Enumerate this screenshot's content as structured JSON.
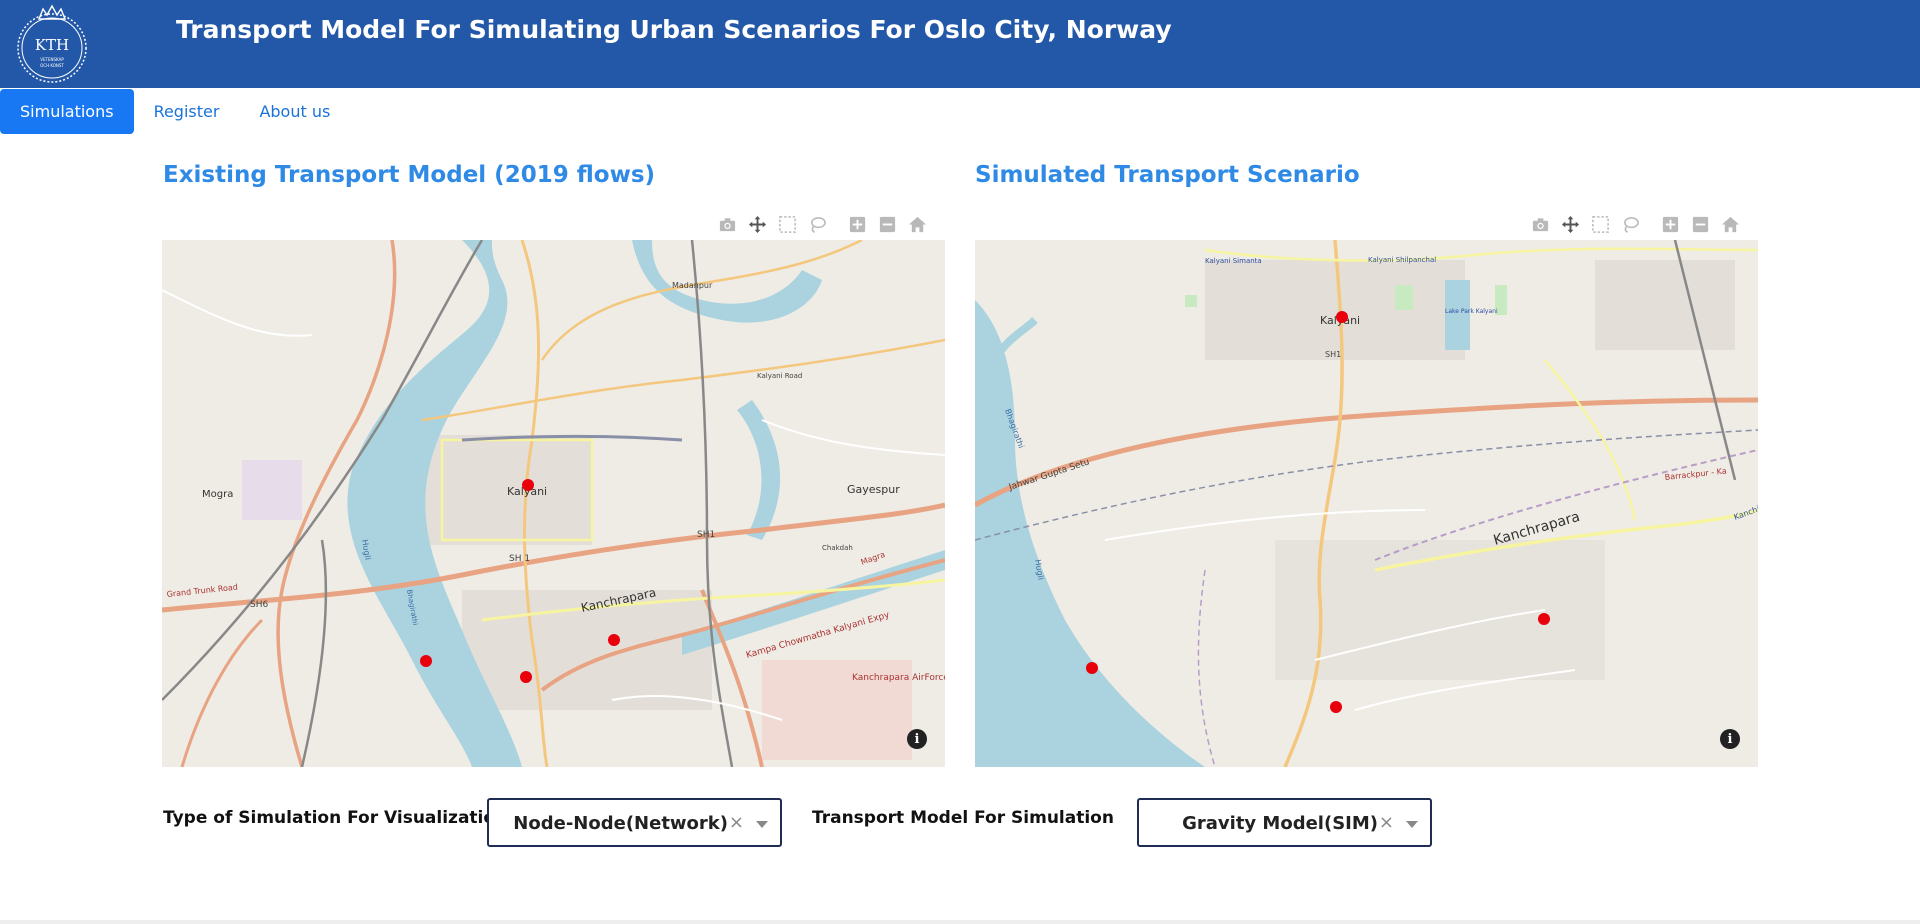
{
  "header": {
    "title": "Transport Model For Simulating Urban Scenarios For Oslo City, Norway",
    "logo_text": "KTH",
    "logo_subtext": "VETENSKAP OCH KONST",
    "background_color": "#2358a8"
  },
  "nav": {
    "items": [
      {
        "label": "Simulations",
        "active": true
      },
      {
        "label": "Register",
        "active": false
      },
      {
        "label": "About us",
        "active": false
      }
    ],
    "active_color": "#1877f2"
  },
  "panels": {
    "existing": {
      "title": "Existing Transport Model (2019 flows)",
      "modebar": [
        "camera-icon",
        "pan-icon",
        "box-select-icon",
        "lasso-select-icon",
        "zoom-in-icon",
        "zoom-out-icon",
        "reset-home-icon"
      ],
      "map_labels": [
        "Kalyani",
        "Kanchrapara",
        "Gayespur",
        "Mogra",
        "SH 1",
        "SH1",
        "SH6",
        "Grand Trunk Road",
        "Kampa Chowmatha Kalyani Expy",
        "Kanchrapara AirForce Area",
        "Hugli",
        "Madanpur",
        "Kalyani Road",
        "Chakdah",
        "Bhagirathi",
        "Magra"
      ],
      "info_label": "i"
    },
    "simulated": {
      "title": "Simulated Transport Scenario",
      "modebar": [
        "camera-icon",
        "pan-icon",
        "box-select-icon",
        "lasso-select-icon",
        "zoom-in-icon",
        "zoom-out-icon",
        "reset-home-icon"
      ],
      "map_labels": [
        "Kalyani",
        "Kanchrapara",
        "Kalyani Simanta",
        "Kalyani Shilpanchal",
        "Lake Park Kalyani",
        "SH1",
        "Jahwar Gupta Setu",
        "Bhagirathi",
        "Hugli",
        "Barrackpur - Ka",
        "Kanchi"
      ],
      "info_label": "i"
    }
  },
  "controls": {
    "simulation_type": {
      "label": "Type of Simulation For Visualization",
      "value": "Node-Node(Network)",
      "clear": "×"
    },
    "transport_model": {
      "label": "Transport Model For Simulation",
      "value": "Gravity Model(SIM)",
      "clear": "×"
    }
  },
  "colors": {
    "title_blue": "#2f8ae6",
    "marker": "#e8000b",
    "water": "#aad3df",
    "land": "#efece5",
    "major_road": "#e8a382"
  }
}
